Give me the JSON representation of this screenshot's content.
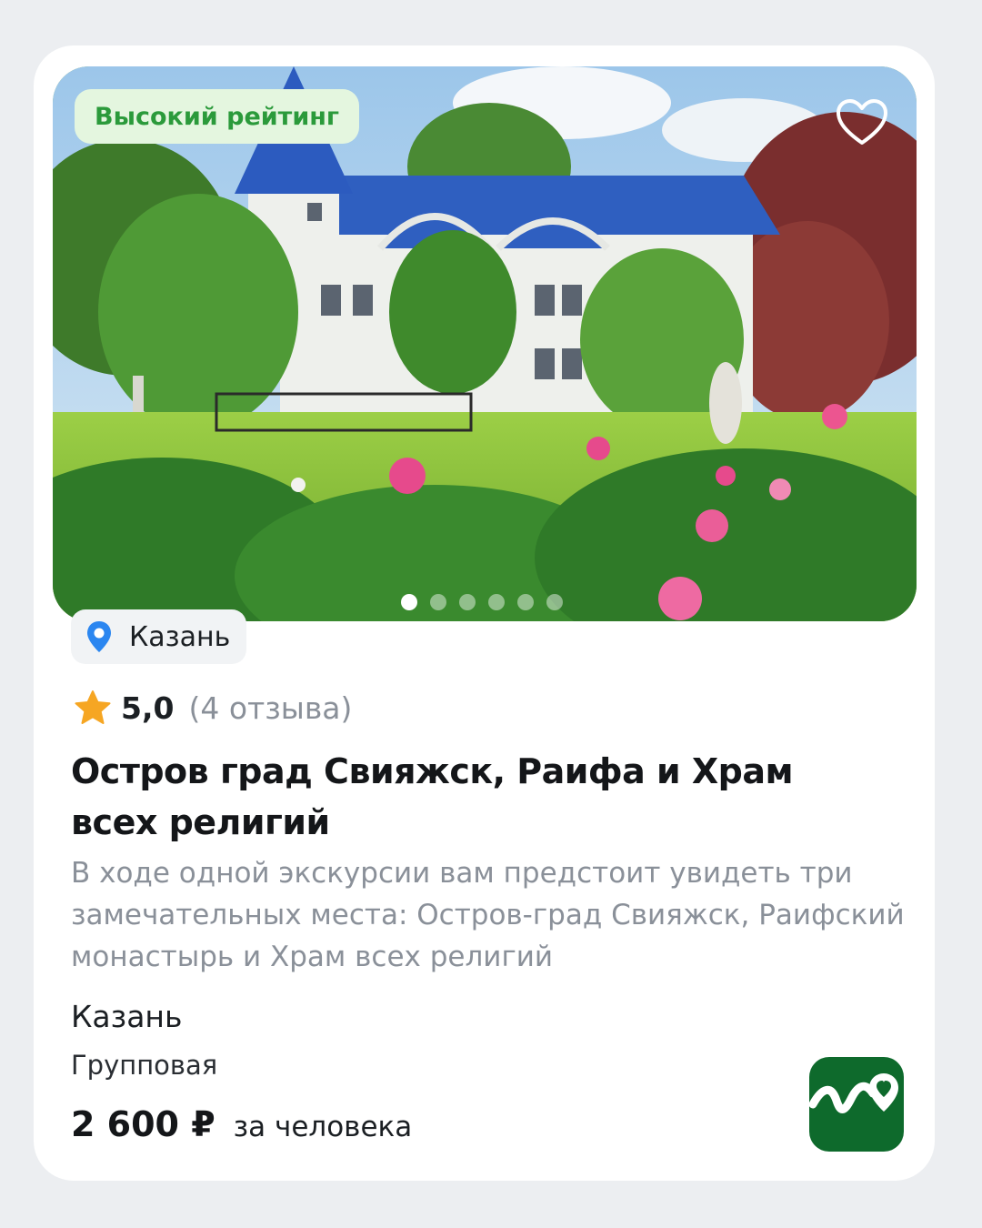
{
  "card": {
    "badge": "Высокий рейтинг",
    "favorite_icon": "heart-outline-icon",
    "carousel": {
      "total": 6,
      "active": 1
    },
    "location_chip": {
      "icon": "map-pin-icon",
      "label": "Казань"
    },
    "rating": {
      "icon": "star-icon",
      "score": "5,0",
      "reviews": "(4 отзыва)"
    },
    "title": "Остров град Свияжск, Раифа и Храм всех религий",
    "description": "В ходе одной экскурсии вам предстоит увидеть три замечательных места: Остров-град Свияжск, Раифский монастырь и Храм всех религий",
    "city": "Казань",
    "tour_type": "Групповая",
    "price": "2 600 ₽",
    "price_unit": "за человека",
    "app_logo": "app-logo-icon"
  },
  "colors": {
    "badge_text": "#2b9a3b",
    "badge_bg": "#e4f6df",
    "pin": "#2b86f0",
    "star": "#f6a623",
    "logo_bg": "#0e6a2c"
  }
}
